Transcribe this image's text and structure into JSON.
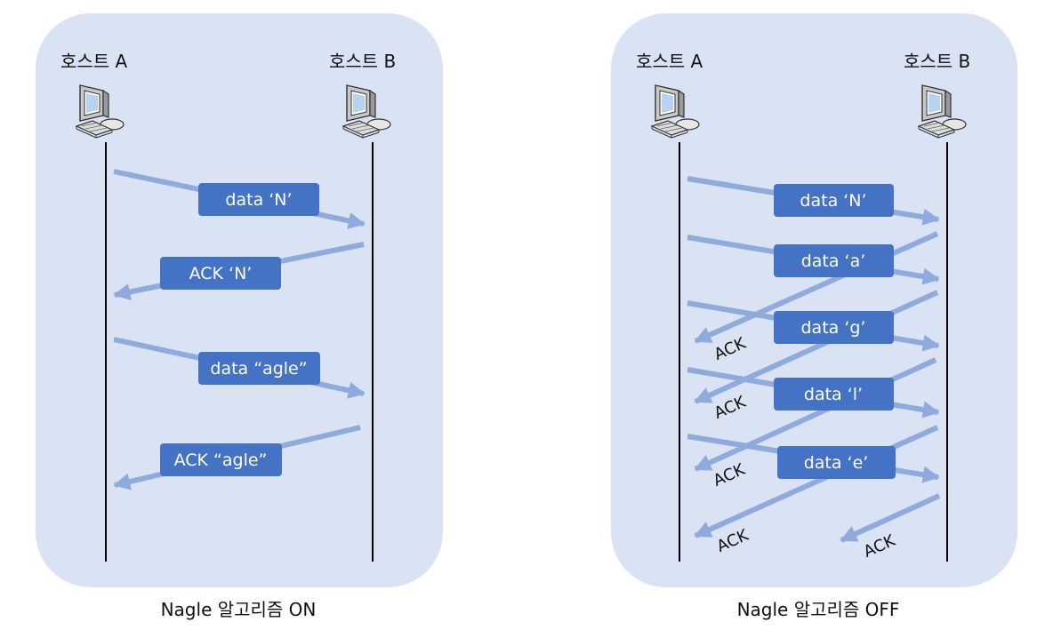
{
  "diagrams": [
    {
      "caption": "Nagle 알고리즘 ON",
      "host_a": "호스트 A",
      "host_b": "호스트 B",
      "messages": [
        {
          "label": "data ‘N’",
          "direction": "A-to-B"
        },
        {
          "label": "ACK ‘N’",
          "direction": "B-to-A"
        },
        {
          "label": "data “agle”",
          "direction": "A-to-B"
        },
        {
          "label": "ACK “agle”",
          "direction": "B-to-A"
        }
      ],
      "acks": []
    },
    {
      "caption": "Nagle 알고리즘 OFF",
      "host_a": "호스트 A",
      "host_b": "호스트 B",
      "messages": [
        {
          "label": "data ‘N’",
          "direction": "A-to-B"
        },
        {
          "label": "data ‘a’",
          "direction": "A-to-B"
        },
        {
          "label": "data ‘g’",
          "direction": "A-to-B"
        },
        {
          "label": "data ‘l’",
          "direction": "A-to-B"
        },
        {
          "label": "data ‘e’",
          "direction": "A-to-B"
        }
      ],
      "acks": [
        {
          "label": "ACK"
        },
        {
          "label": "ACK"
        },
        {
          "label": "ACK"
        },
        {
          "label": "ACK"
        },
        {
          "label": "ACK"
        }
      ]
    }
  ],
  "colors": {
    "panel_bg": "#dae3f3",
    "arrow": "#8faadc",
    "box_fill": "#4472c4",
    "box_text": "#ffffff",
    "lifeline": "#000000"
  },
  "icons": {
    "host": "computer-icon"
  }
}
